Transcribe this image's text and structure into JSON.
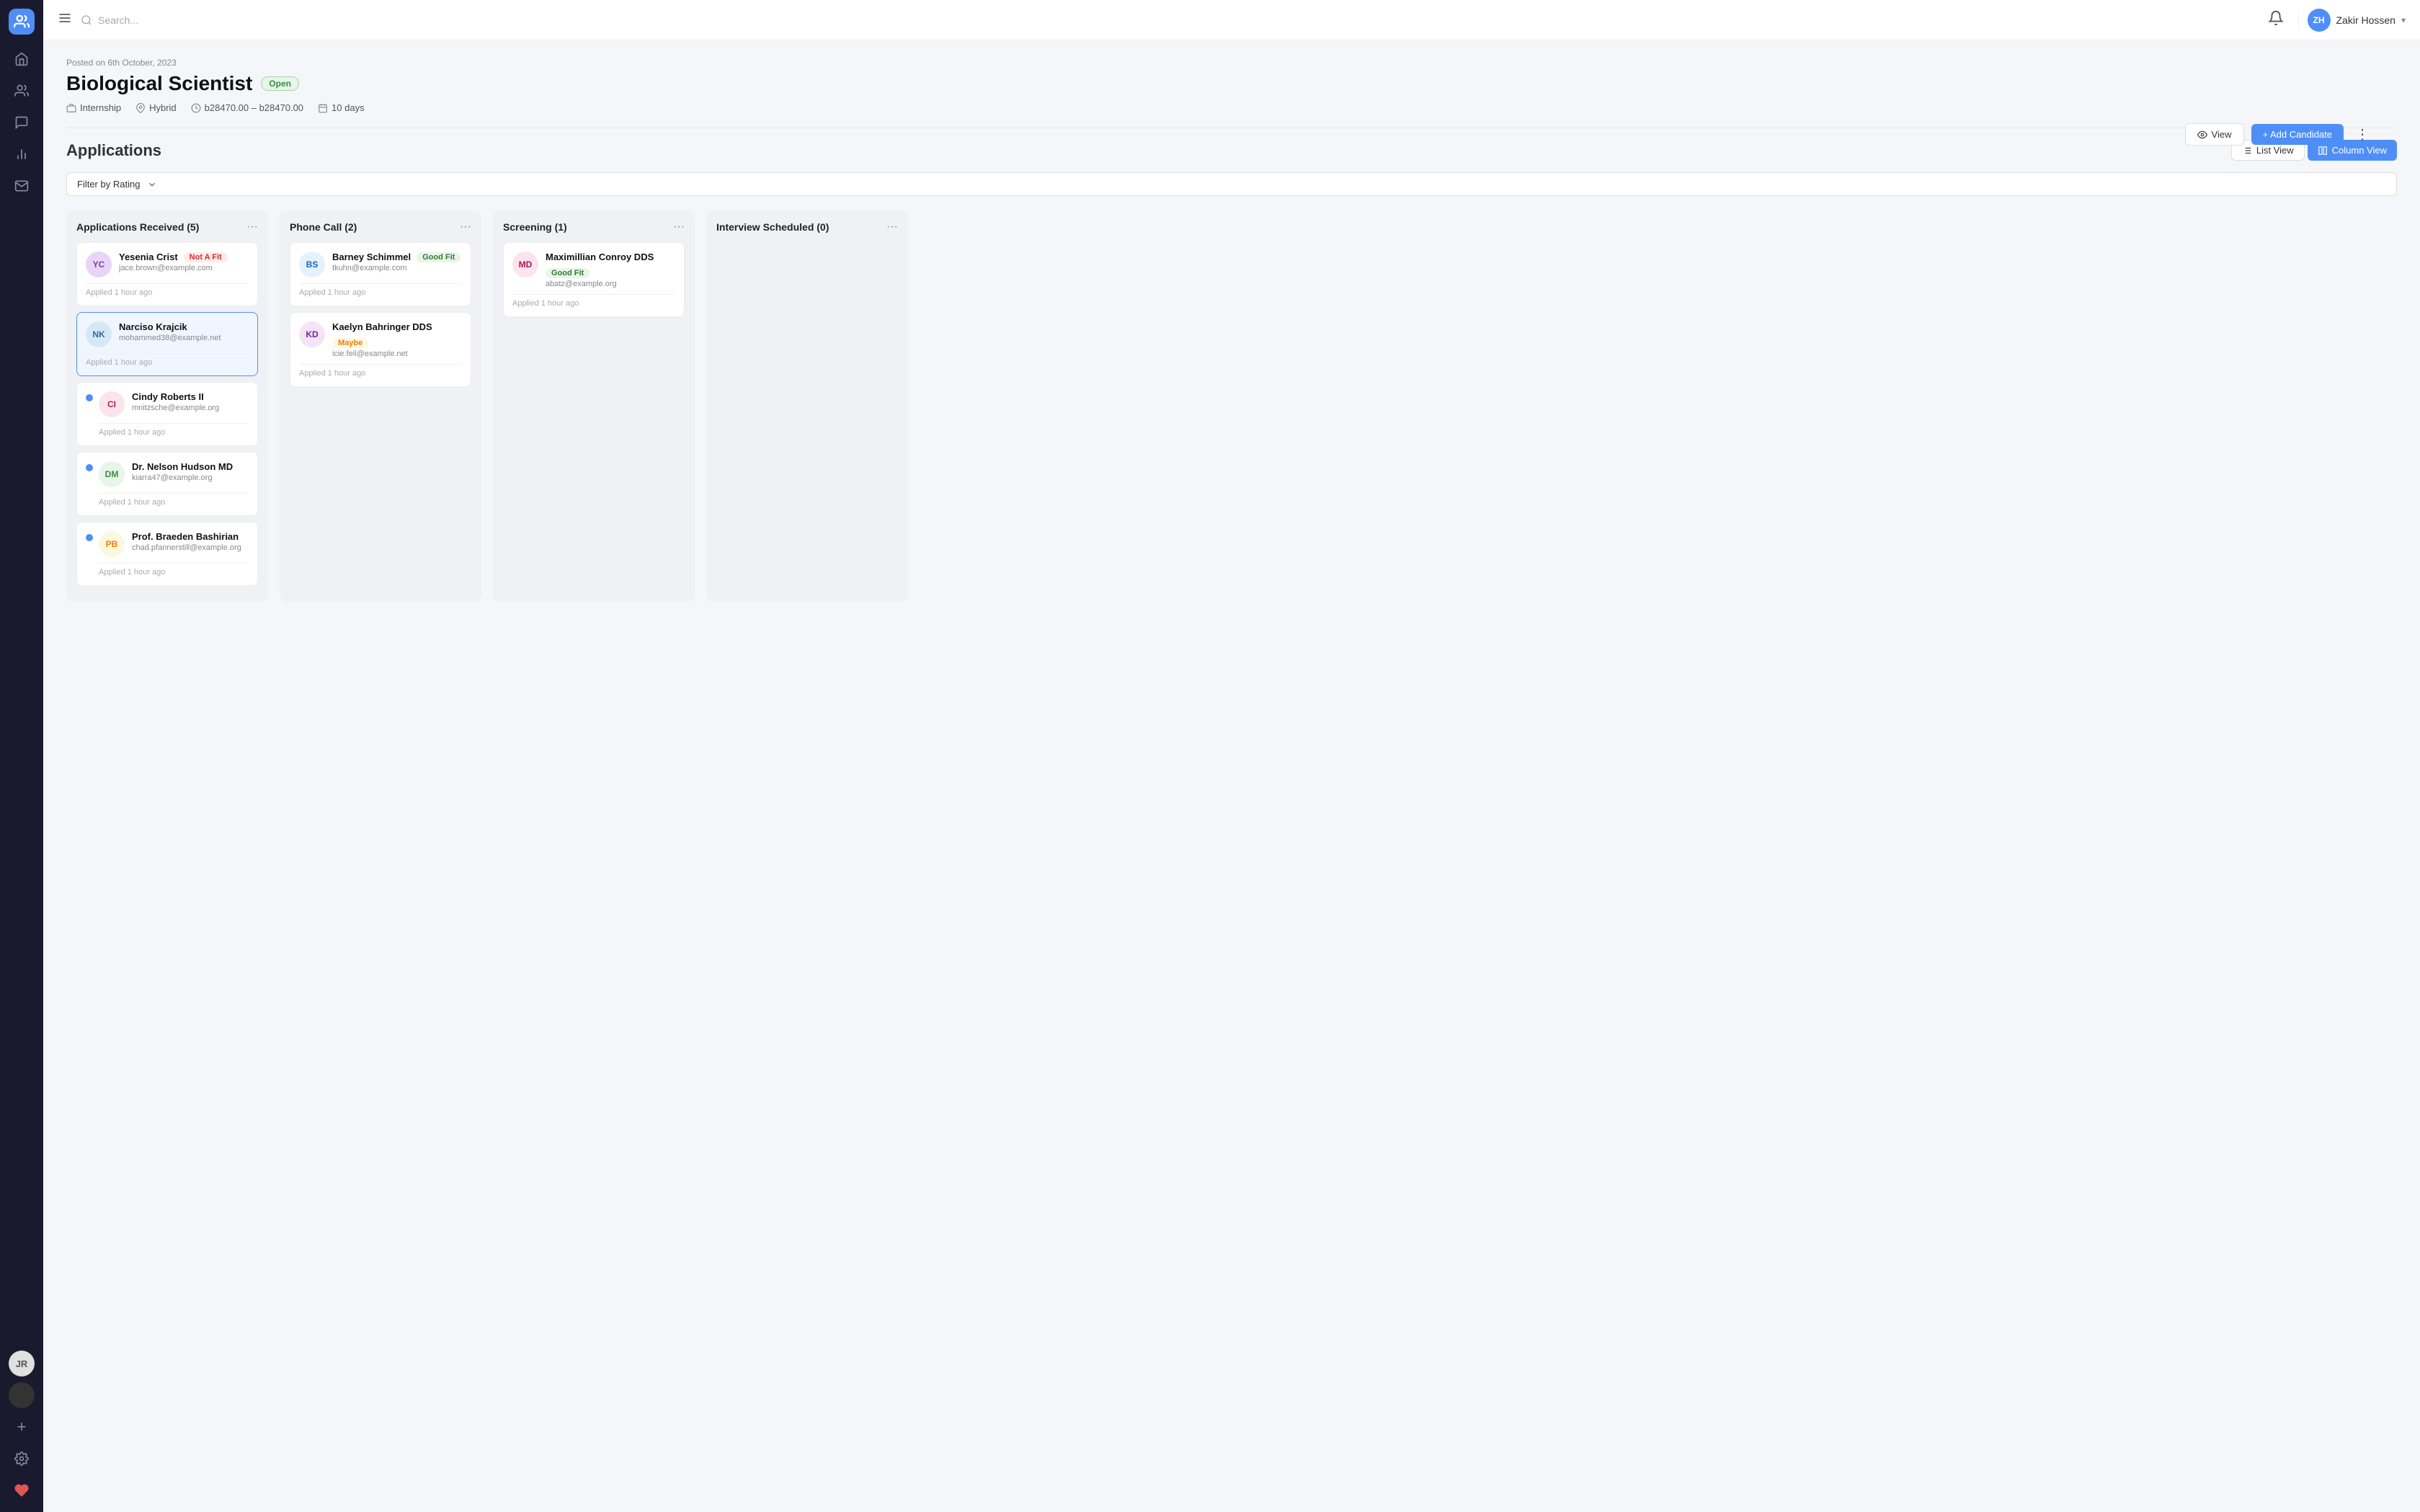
{
  "sidebar": {
    "logo_initials": "🤝",
    "items": [
      {
        "name": "home",
        "icon": "🏠",
        "active": false
      },
      {
        "name": "people",
        "icon": "👥",
        "active": false
      },
      {
        "name": "messages",
        "icon": "💬",
        "active": false
      },
      {
        "name": "charts",
        "icon": "📊",
        "active": false
      },
      {
        "name": "mail",
        "icon": "📧",
        "active": false
      }
    ],
    "avatar1": {
      "initials": "JR",
      "active": false
    },
    "avatar2": {
      "initials": "",
      "active": true
    },
    "add_label": "+",
    "settings_icon": "⚙",
    "heart_icon": "❤"
  },
  "topbar": {
    "menu_icon": "☰",
    "search_placeholder": "Search...",
    "bell_icon": "🔔",
    "user": {
      "initials": "ZH",
      "name": "Zakir Hossen",
      "chevron": "▾"
    }
  },
  "job": {
    "posted_date": "Posted on 6th October, 2023",
    "title": "Biological Scientist",
    "status": "Open",
    "employment_type": "Internship",
    "work_mode": "Hybrid",
    "salary_range": "b28470.00 – b28470.00",
    "duration": "10 days",
    "actions": {
      "view_label": "View",
      "add_candidate_label": "+ Add Candidate",
      "more_icon": "⋮"
    }
  },
  "applications": {
    "title": "Applications",
    "filter_label": "Filter by Rating",
    "list_view_label": "List View",
    "column_view_label": "Column View",
    "columns": [
      {
        "id": "applications_received",
        "title": "Applications Received (5)",
        "more_icon": "···",
        "cards": [
          {
            "initials": "YC",
            "avatar_bg": "#e8d5f5",
            "avatar_color": "#7b3fa0",
            "name": "Yesenia Crist",
            "badge": "Not A Fit",
            "badge_type": "notafit",
            "email": "jace.brown@example.com",
            "time": "Applied 1 hour ago",
            "new_dot": false,
            "selected": false
          },
          {
            "initials": "NK",
            "avatar_bg": "#d5e8f5",
            "avatar_color": "#2a6fa0",
            "name": "Narciso Krajcik",
            "badge": "",
            "badge_type": "",
            "email": "mohammed38@example.net",
            "time": "Applied 1 hour ago",
            "new_dot": false,
            "selected": true
          },
          {
            "initials": "CI",
            "avatar_bg": "#fce4ec",
            "avatar_color": "#c2185b",
            "name": "Cindy Roberts II",
            "badge": "",
            "badge_type": "",
            "email": "mnitzsche@example.org",
            "time": "Applied 1 hour ago",
            "new_dot": true,
            "selected": false
          },
          {
            "initials": "DM",
            "avatar_bg": "#e8f5e9",
            "avatar_color": "#388e3c",
            "name": "Dr. Nelson Hudson MD",
            "badge": "",
            "badge_type": "",
            "email": "kiarra47@example.org",
            "time": "Applied 1 hour ago",
            "new_dot": true,
            "selected": false
          },
          {
            "initials": "PB",
            "avatar_bg": "#fff8e1",
            "avatar_color": "#f57c00",
            "name": "Prof. Braeden Bashirian",
            "badge": "",
            "badge_type": "",
            "email": "chad.pfannerstill@example.org",
            "time": "Applied 1 hour ago",
            "new_dot": true,
            "selected": false
          }
        ]
      },
      {
        "id": "phone_call",
        "title": "Phone Call (2)",
        "more_icon": "···",
        "cards": [
          {
            "initials": "BS",
            "avatar_bg": "#e3f2fd",
            "avatar_color": "#1565c0",
            "name": "Barney Schimmel",
            "badge": "Good Fit",
            "badge_type": "goodfit",
            "email": "tkuhn@example.com",
            "time": "Applied 1 hour ago",
            "new_dot": false,
            "selected": false
          },
          {
            "initials": "KD",
            "avatar_bg": "#f3e5f5",
            "avatar_color": "#7b1fa2",
            "name": "Kaelyn Bahringer DDS",
            "badge": "Maybe",
            "badge_type": "maybe",
            "email": "icie.feil@example.net",
            "time": "Applied 1 hour ago",
            "new_dot": false,
            "selected": false
          }
        ]
      },
      {
        "id": "screening",
        "title": "Screening (1)",
        "more_icon": "···",
        "cards": [
          {
            "initials": "MD",
            "avatar_bg": "#fce4ec",
            "avatar_color": "#ad1457",
            "name": "Maximillian Conroy DDS",
            "badge": "Good Fit",
            "badge_type": "goodfit",
            "email": "abatz@example.org",
            "time": "Applied 1 hour ago",
            "new_dot": false,
            "selected": false
          }
        ]
      },
      {
        "id": "interview_scheduled",
        "title": "Interview Scheduled (0)",
        "more_icon": "···",
        "cards": []
      }
    ]
  }
}
